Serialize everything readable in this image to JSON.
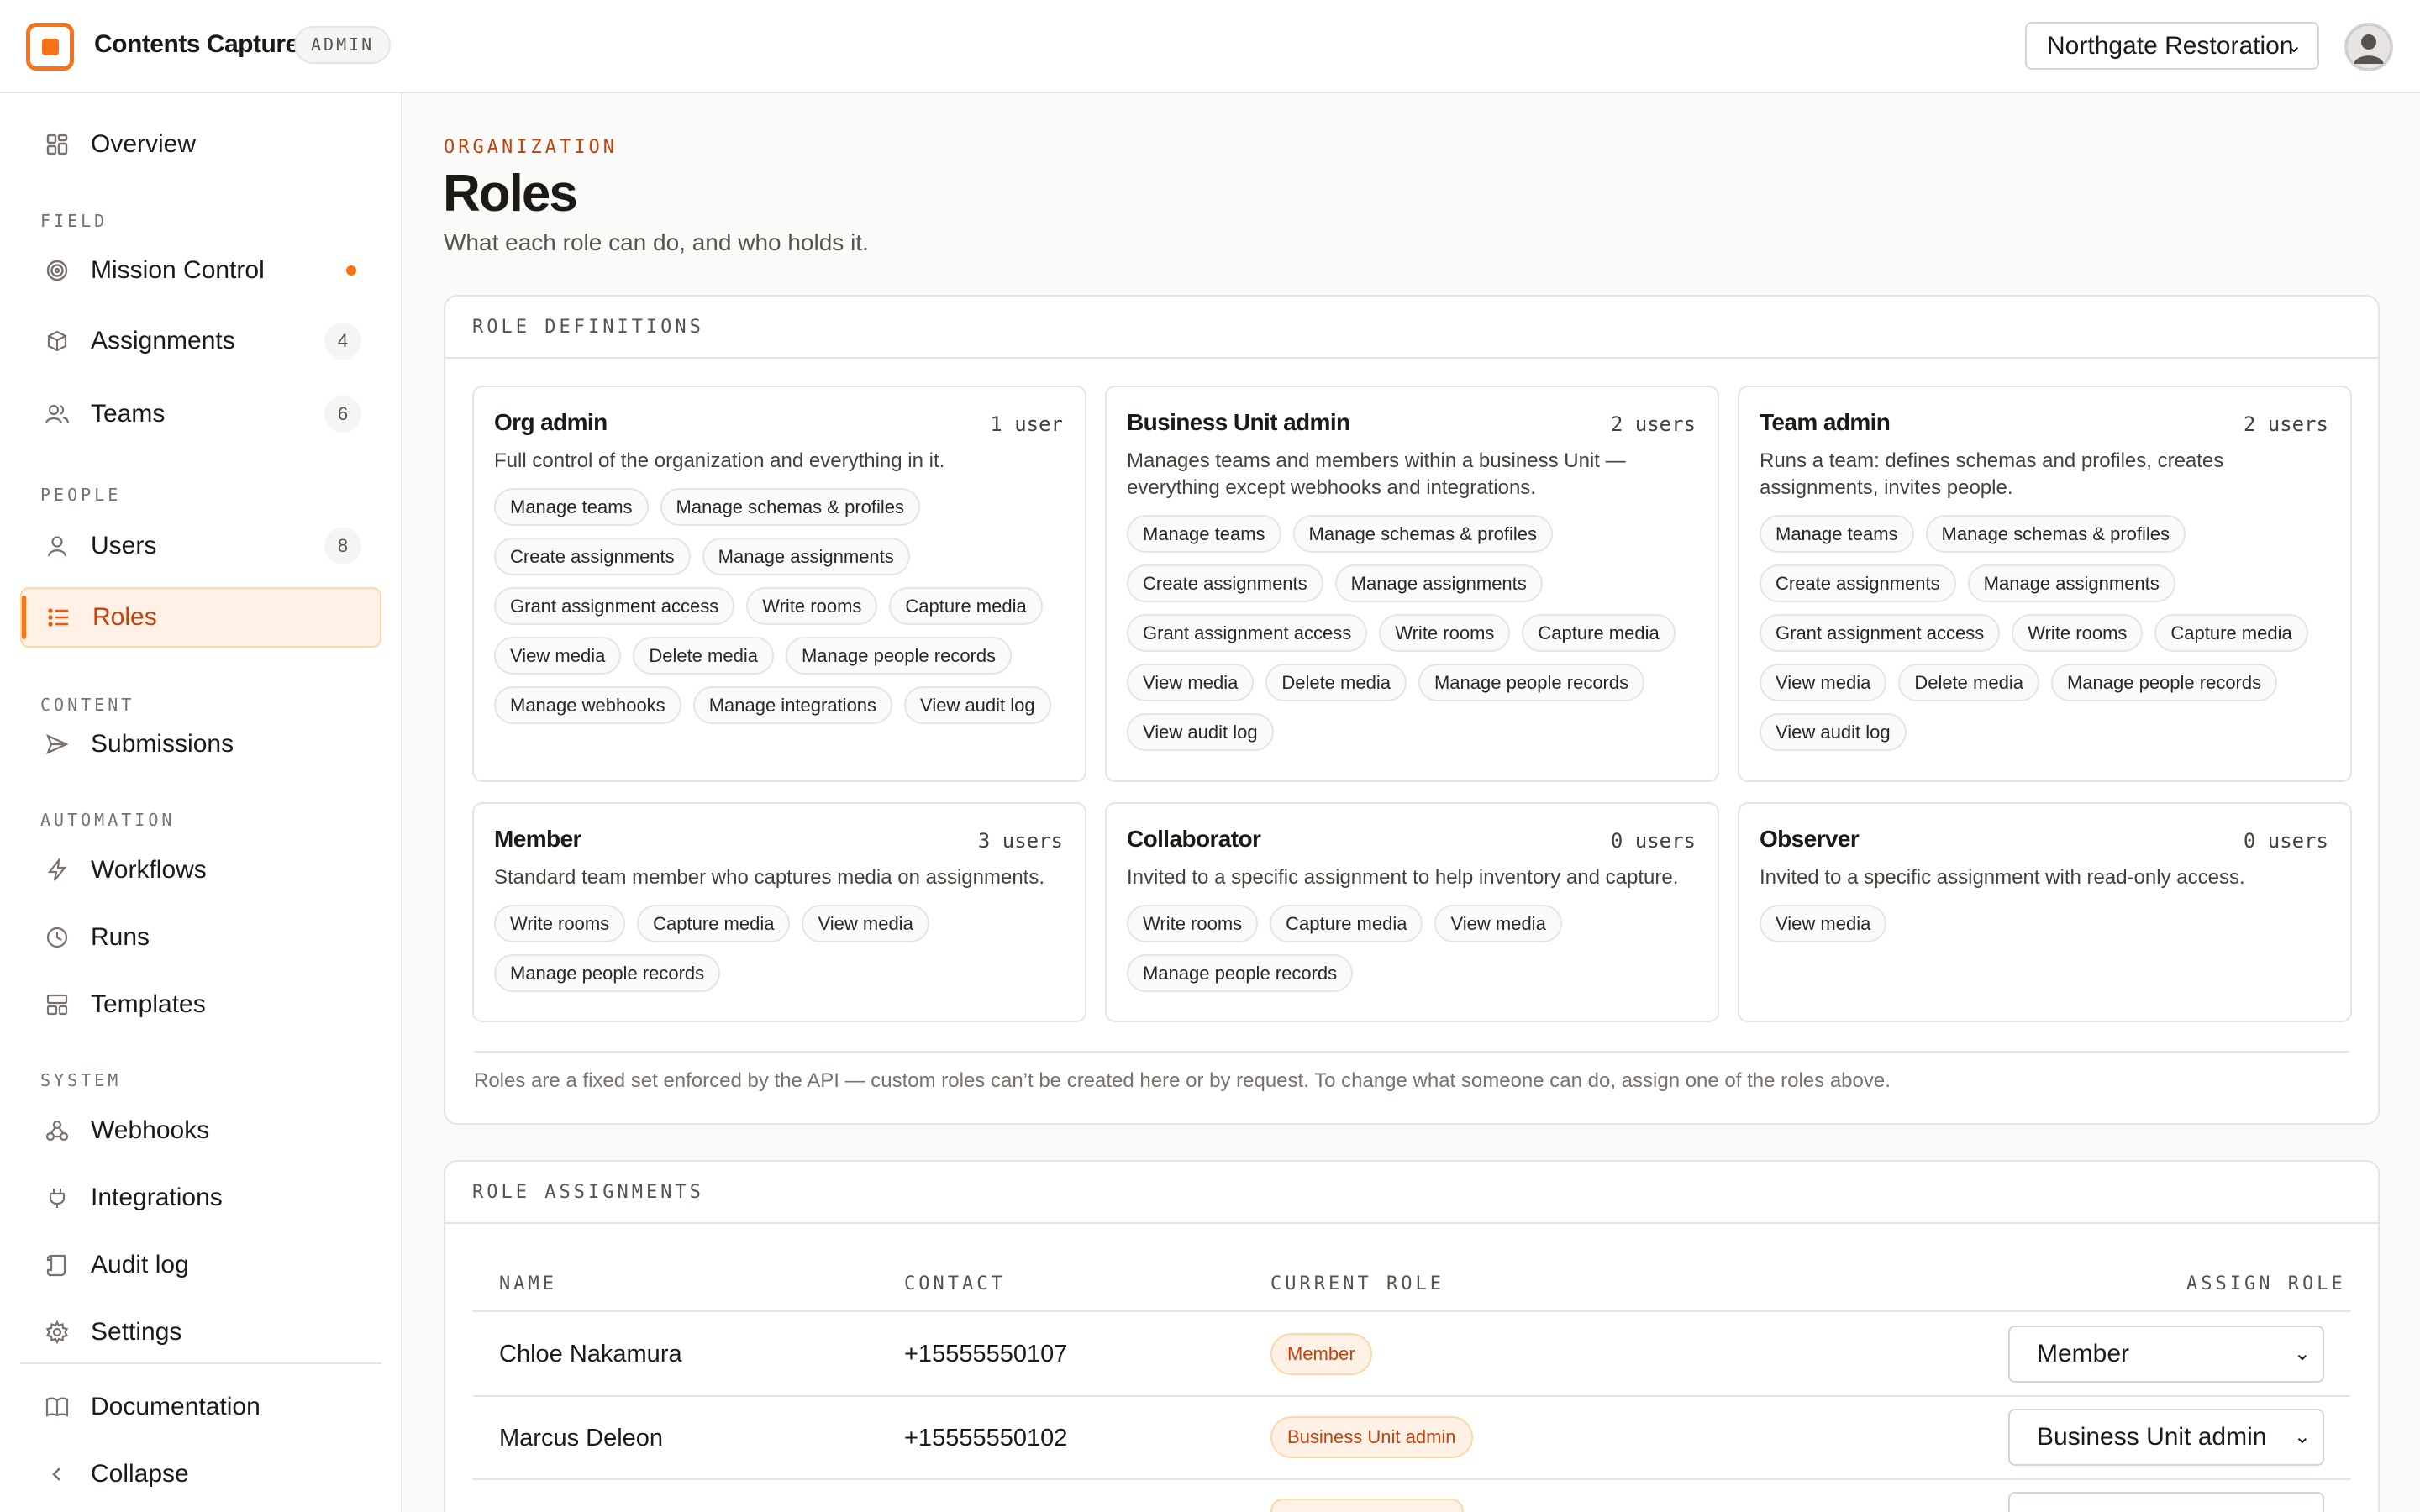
{
  "app": {
    "title": "Contents Capture",
    "badge": "ADMIN",
    "org_selected": "Northgate Restoration"
  },
  "sidebar": {
    "overview": "Overview",
    "sections": {
      "field": "FIELD",
      "people": "PEOPLE",
      "content": "CONTENT",
      "automation": "AUTOMATION",
      "system": "SYSTEM"
    },
    "items": {
      "mission_control": "Mission Control",
      "assignments": "Assignments",
      "assignments_count": "4",
      "teams": "Teams",
      "teams_count": "6",
      "users": "Users",
      "users_count": "8",
      "roles": "Roles",
      "submissions": "Submissions",
      "workflows": "Workflows",
      "runs": "Runs",
      "templates": "Templates",
      "webhooks": "Webhooks",
      "integrations": "Integrations",
      "audit_log": "Audit log",
      "settings": "Settings",
      "documentation": "Documentation",
      "collapse": "Collapse"
    }
  },
  "page": {
    "eyebrow": "ORGANIZATION",
    "title": "Roles",
    "subtitle": "What each role can do, and who holds it."
  },
  "definitions": {
    "heading": "ROLE DEFINITIONS",
    "roles": [
      {
        "name": "Org admin",
        "users": "1 user",
        "description": "Full control of the organization and everything in it.",
        "permissions": [
          "Manage teams",
          "Manage schemas & profiles",
          "Create assignments",
          "Manage assignments",
          "Grant assignment access",
          "Write rooms",
          "Capture media",
          "View media",
          "Delete media",
          "Manage people records",
          "Manage webhooks",
          "Manage integrations",
          "View audit log"
        ]
      },
      {
        "name": "Business Unit admin",
        "users": "2 users",
        "description": "Manages teams and members within a business Unit — everything except webhooks and integrations.",
        "permissions": [
          "Manage teams",
          "Manage schemas & profiles",
          "Create assignments",
          "Manage assignments",
          "Grant assignment access",
          "Write rooms",
          "Capture media",
          "View media",
          "Delete media",
          "Manage people records",
          "View audit log"
        ]
      },
      {
        "name": "Team admin",
        "users": "2 users",
        "description": "Runs a team: defines schemas and profiles, creates assignments, invites people.",
        "permissions": [
          "Manage teams",
          "Manage schemas & profiles",
          "Create assignments",
          "Manage assignments",
          "Grant assignment access",
          "Write rooms",
          "Capture media",
          "View media",
          "Delete media",
          "Manage people records",
          "View audit log"
        ]
      },
      {
        "name": "Member",
        "users": "3 users",
        "description": "Standard team member who captures media on assignments.",
        "permissions": [
          "Write rooms",
          "Capture media",
          "View media",
          "Manage people records"
        ]
      },
      {
        "name": "Collaborator",
        "users": "0 users",
        "description": "Invited to a specific assignment to help inventory and capture.",
        "permissions": [
          "Write rooms",
          "Capture media",
          "View media",
          "Manage people records"
        ]
      },
      {
        "name": "Observer",
        "users": "0 users",
        "description": "Invited to a specific assignment with read-only access.",
        "permissions": [
          "View media"
        ]
      }
    ],
    "note": "Roles are a fixed set enforced by the API — custom roles can’t be created here or by request. To change what someone can do, assign one of the roles above."
  },
  "assignments": {
    "heading": "ROLE ASSIGNMENTS",
    "columns": [
      "NAME",
      "CONTACT",
      "CURRENT ROLE",
      "ASSIGN ROLE"
    ],
    "rows": [
      {
        "name": "Chloe Nakamura",
        "contact": "+15555550107",
        "role": "Member",
        "assign": "Member"
      },
      {
        "name": "Marcus Deleon",
        "contact": "+15555550102",
        "role": "Business Unit admin",
        "assign": "Business Unit admin"
      }
    ]
  }
}
